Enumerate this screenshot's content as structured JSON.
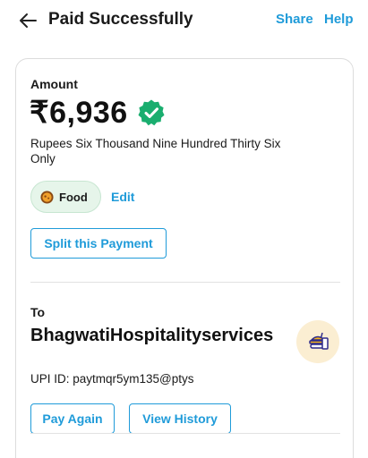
{
  "header": {
    "title": "Paid Successfully",
    "share_label": "Share",
    "help_label": "Help"
  },
  "payment": {
    "amount_label": "Amount",
    "amount_value": "₹6,936",
    "amount_words": "Rupees Six Thousand Nine Hundred Thirty Six Only",
    "category_label": "Food",
    "edit_label": "Edit",
    "split_label": "Split this Payment"
  },
  "recipient": {
    "to_label": "To",
    "name": "BhagwatiHospitalityservices",
    "upi_id": "UPI ID: paytmqr5ym135@ptys",
    "pay_again_label": "Pay Again",
    "view_history_label": "View History"
  },
  "icons": {
    "back": "back-arrow-icon",
    "verified": "verified-badge-icon",
    "category": "food-icon",
    "merchant": "food-merchant-icon"
  },
  "colors": {
    "accent": "#1f9bd9",
    "verified": "#1aae6f",
    "category_chip_bg": "#e6f5ea",
    "merchant_avatar_bg": "#fbeed2"
  }
}
